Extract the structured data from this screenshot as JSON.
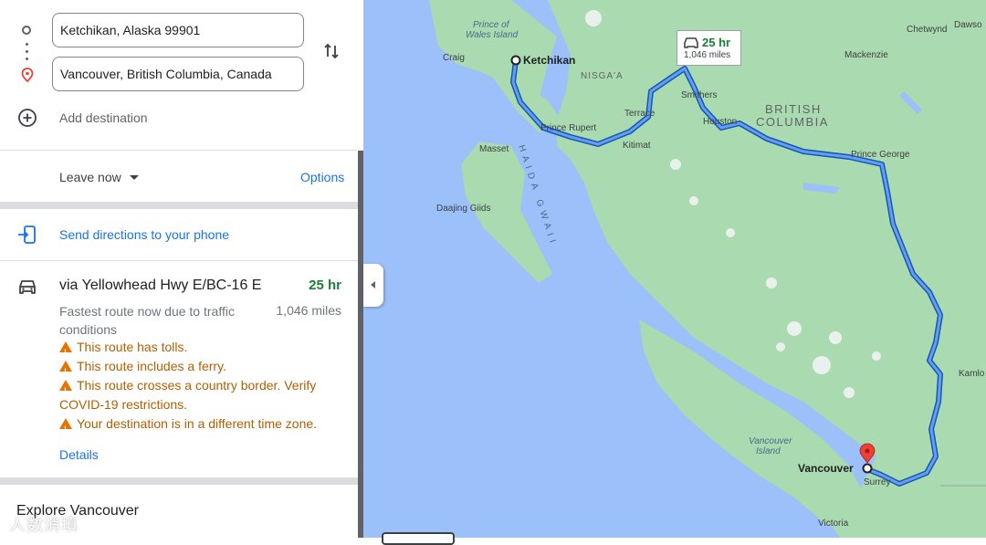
{
  "directions": {
    "origin_value": "Ketchikan, Alaska 99901",
    "destination_value": "Vancouver, British Columbia, Canada",
    "add_destination_label": "Add destination",
    "origin_icon": "circle-icon",
    "destination_icon": "location-pin-icon",
    "swap_icon": "swap-vertical-icon",
    "add_icon": "add-circle-icon"
  },
  "options_bar": {
    "leave_now_label": "Leave now",
    "options_label": "Options"
  },
  "send_to_phone": {
    "label": "Send directions to your phone",
    "icon": "send-to-phone-icon"
  },
  "route": {
    "icon": "car-icon",
    "title": "via Yellowhead Hwy E/BC-16 E",
    "time": "25 hr",
    "distance": "1,046 miles",
    "description": "Fastest route now due to traffic conditions",
    "warnings": [
      "This route has tolls.",
      "This route includes a ferry.",
      "This route crosses a country border. Verify COVID-19 restrictions.",
      "Your destination is in a different time zone."
    ],
    "details_label": "Details"
  },
  "explore_label": "Explore Vancouver",
  "watermark": "人数消填",
  "map": {
    "colors": {
      "water": "#9cc0f9",
      "land": "#aadaaf",
      "route": "#1a73e8",
      "route_outline": "#1558b0",
      "text": "#3c4043"
    },
    "route_box": {
      "time": "25 hr",
      "distance": "1,046 miles"
    },
    "labels": {
      "prince_of_wales": "Prince of\nWales Island",
      "craig": "Craig",
      "ketchikan": "Ketchikan",
      "nisgaa": "NISGA'A",
      "smithers": "Smithers",
      "houston": "Houston",
      "british_columbia": "BRITISH\nCOLUMBIA",
      "terrace": "Terrace",
      "prince_rupert": "Prince Rupert",
      "kitimat": "Kitimat",
      "masset": "Masset",
      "haida_gwaii": "HAIDA GWAII",
      "daajing_giids": "Daajing Giids",
      "prince_george": "Prince George",
      "mackenzie": "Mackenzie",
      "chetwynd": "Chetwynd",
      "dawson": "Dawso",
      "kamloops": "Kamlo",
      "vancouver_island": "Vancouver\nIsland",
      "vancouver": "Vancouver",
      "surrey": "Surrey",
      "victoria": "Victoria"
    }
  }
}
